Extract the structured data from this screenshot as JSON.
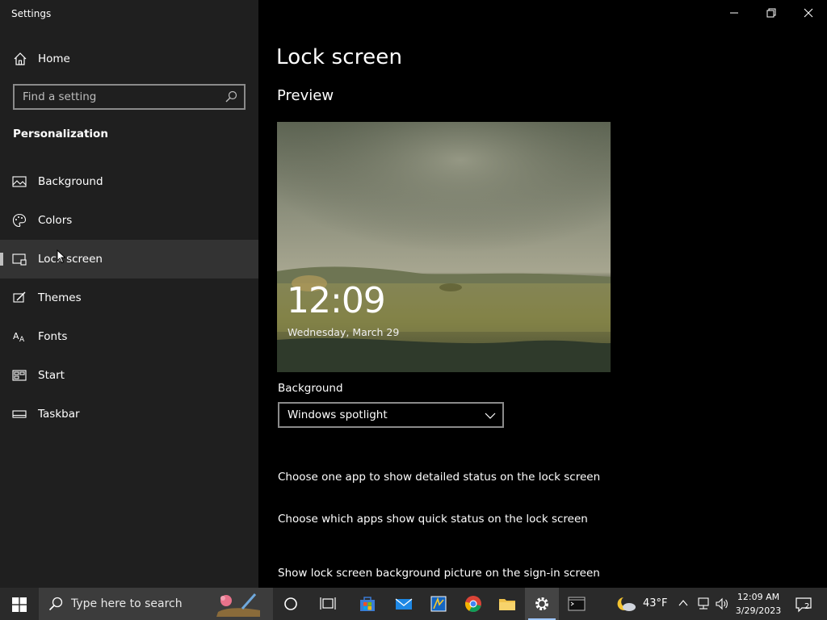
{
  "window": {
    "title": "Settings",
    "minimize_icon": "minimize-icon",
    "restore_icon": "restore-icon",
    "close_icon": "close-icon"
  },
  "sidebar": {
    "home_label": "Home",
    "search_placeholder": "Find a setting",
    "section_title": "Personalization",
    "items": [
      {
        "label": "Background",
        "icon": "picture-icon"
      },
      {
        "label": "Colors",
        "icon": "palette-icon"
      },
      {
        "label": "Lock screen",
        "icon": "lock-screen-icon",
        "active": true
      },
      {
        "label": "Themes",
        "icon": "brush-icon"
      },
      {
        "label": "Fonts",
        "icon": "font-icon"
      },
      {
        "label": "Start",
        "icon": "start-icon"
      },
      {
        "label": "Taskbar",
        "icon": "taskbar-icon"
      }
    ]
  },
  "main": {
    "title": "Lock screen",
    "preview_heading": "Preview",
    "preview_time": "12:09",
    "preview_date": "Wednesday, March 29",
    "background_label": "Background",
    "background_value": "Windows spotlight",
    "link_detailed_status": "Choose one app to show detailed status on the lock screen",
    "link_quick_status": "Choose which apps show quick status on the lock screen",
    "link_signin_background": "Show lock screen background picture on the sign-in screen"
  },
  "taskbar": {
    "search_placeholder": "Type here to search",
    "apps": [
      "cortana-icon",
      "task-view-icon",
      "store-icon",
      "mail-icon",
      "app-icon",
      "chrome-icon",
      "file-explorer-icon",
      "settings-icon",
      "terminal-icon"
    ],
    "weather_temp": "43°F",
    "clock_time": "12:09 AM",
    "clock_date": "3/29/2023",
    "notification_count": "2"
  },
  "colors": {
    "sidebar_bg": "#1f1f1f",
    "main_bg": "#000000",
    "taskbar_bg": "#2a2a2a",
    "active_item_bg": "#333333"
  }
}
